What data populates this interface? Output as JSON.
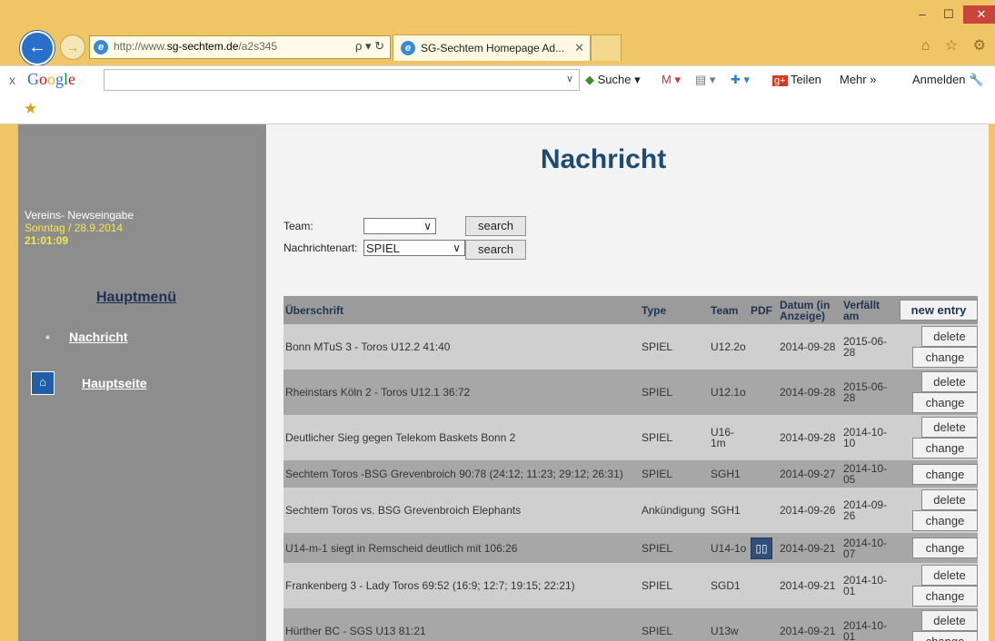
{
  "browser": {
    "window_controls": [
      "–",
      "☐",
      "✕"
    ],
    "address": {
      "url_prefix": "http://www.",
      "url_domain": "sg-sechtem.de",
      "url_path": "/a2s345",
      "search_glyph": "ρ ▾ ↻"
    },
    "tab": {
      "title": "SG-Sechtem Homepage Ad...",
      "close": "✕"
    },
    "top_icons": "⌂ ☆ ⚙"
  },
  "googlebar": {
    "close": "x",
    "logo": "Google",
    "suche": "Suche ▾",
    "gmail": "M ▾",
    "teilen": "Teilen",
    "mehr": "Mehr »",
    "anmelden": "Anmelden"
  },
  "sidebar": {
    "vereins_title": "Vereins- Newseingabe",
    "date": "Sonntag / 28.9.2014",
    "time": "21:01:09",
    "menu_title": "Hauptmenü",
    "nav_nachricht": "Nachricht",
    "nav_hauptseite": "Hauptseite"
  },
  "main": {
    "title": "Nachricht",
    "filter": {
      "team_label": "Team:",
      "team_value": "",
      "type_label": "Nachrichtenart:",
      "type_value": "SPIEL",
      "search_label": "search"
    },
    "table": {
      "headers": {
        "title": "Überschrift",
        "type": "Type",
        "team": "Team",
        "pdf": "PDF",
        "date": "Datum (in Anzeige)",
        "expires": "Verfällt am"
      },
      "new_entry_label": "new entry",
      "delete_label": "delete",
      "change_label": "change",
      "rows": [
        {
          "title": "Bonn MTuS 3 - Toros U12.2 41:40",
          "type": "SPIEL",
          "team": "U12.2o",
          "date": "2014-09-28",
          "expires": "2015-06-28"
        },
        {
          "title": "Rheinstars Köln 2 - Toros U12.1 36:72",
          "type": "SPIEL",
          "team": "U12.1o",
          "date": "2014-09-28",
          "expires": "2015-06-28"
        },
        {
          "title": "Deutlicher Sieg gegen Telekom Baskets Bonn 2",
          "type": "SPIEL",
          "team": "U16-1m",
          "date": "2014-09-28",
          "expires": "2014-10-10"
        },
        {
          "title": "Sechtem Toros -BSG Grevenbroich 90:78 (24:12; 11:23; 29:12; 26:31)",
          "type": "SPIEL",
          "team": "SGH1",
          "date": "2014-09-27",
          "expires": "2014-10-05"
        },
        {
          "title": "Sechtem Toros vs. BSG Grevenbroich Elephants",
          "type": "Ankündigung",
          "team": "SGH1",
          "date": "2014-09-26",
          "expires": "2014-09-26"
        },
        {
          "title": "U14-m-1 siegt in Remscheid deutlich mit 106:26",
          "type": "SPIEL",
          "team": "U14-1o",
          "date": "2014-09-21",
          "expires": "2014-10-07"
        },
        {
          "title": "Frankenberg 3 - Lady Toros 69:52 (16:9; 12:7; 19:15; 22:21)",
          "type": "SPIEL",
          "team": "SGD1",
          "date": "2014-09-21",
          "expires": "2014-10-01"
        },
        {
          "title": "Hürther BC - SGS U13 81:21",
          "type": "SPIEL",
          "team": "U13w",
          "date": "2014-09-21",
          "expires": "2014-10-01"
        }
      ]
    }
  }
}
